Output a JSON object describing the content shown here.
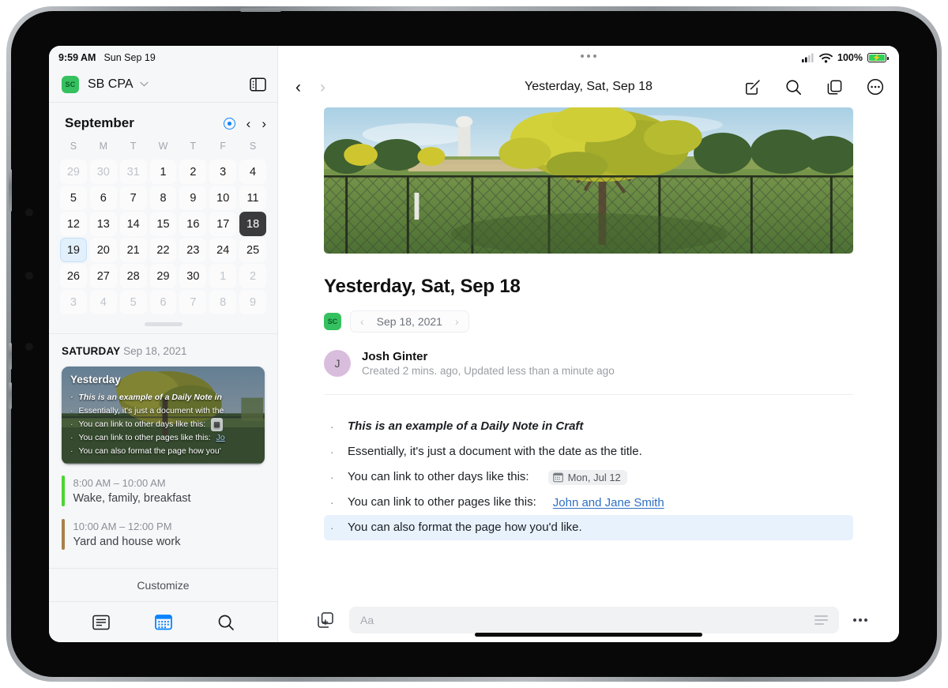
{
  "sidebar": {
    "status": {
      "time": "9:59 AM",
      "date": "Sun Sep 19"
    },
    "account": {
      "badge": "SC",
      "name": "SB CPA",
      "chevron": "⌄"
    },
    "calendar": {
      "month": "September",
      "prev": "‹",
      "next": "›",
      "dow": [
        "S",
        "M",
        "T",
        "W",
        "T",
        "F",
        "S"
      ],
      "weeks": [
        [
          {
            "n": "29",
            "state": "muted"
          },
          {
            "n": "30",
            "state": "muted"
          },
          {
            "n": "31",
            "state": "muted"
          },
          {
            "n": "1",
            "state": "normal"
          },
          {
            "n": "2",
            "state": "normal"
          },
          {
            "n": "3",
            "state": "normal"
          },
          {
            "n": "4",
            "state": "normal"
          }
        ],
        [
          {
            "n": "5",
            "state": "normal"
          },
          {
            "n": "6",
            "state": "normal"
          },
          {
            "n": "7",
            "state": "normal"
          },
          {
            "n": "8",
            "state": "normal"
          },
          {
            "n": "9",
            "state": "normal"
          },
          {
            "n": "10",
            "state": "normal"
          },
          {
            "n": "11",
            "state": "normal"
          }
        ],
        [
          {
            "n": "12",
            "state": "normal"
          },
          {
            "n": "13",
            "state": "normal"
          },
          {
            "n": "14",
            "state": "normal"
          },
          {
            "n": "15",
            "state": "normal"
          },
          {
            "n": "16",
            "state": "normal"
          },
          {
            "n": "17",
            "state": "normal"
          },
          {
            "n": "18",
            "state": "selected"
          }
        ],
        [
          {
            "n": "19",
            "state": "today"
          },
          {
            "n": "20",
            "state": "normal"
          },
          {
            "n": "21",
            "state": "normal"
          },
          {
            "n": "22",
            "state": "normal"
          },
          {
            "n": "23",
            "state": "normal"
          },
          {
            "n": "24",
            "state": "normal"
          },
          {
            "n": "25",
            "state": "normal"
          }
        ],
        [
          {
            "n": "26",
            "state": "normal"
          },
          {
            "n": "27",
            "state": "normal"
          },
          {
            "n": "28",
            "state": "normal"
          },
          {
            "n": "29",
            "state": "normal"
          },
          {
            "n": "30",
            "state": "normal"
          },
          {
            "n": "1",
            "state": "muted"
          },
          {
            "n": "2",
            "state": "muted"
          }
        ],
        [
          {
            "n": "3",
            "state": "muted"
          },
          {
            "n": "4",
            "state": "muted"
          },
          {
            "n": "5",
            "state": "muted"
          },
          {
            "n": "6",
            "state": "muted"
          },
          {
            "n": "7",
            "state": "muted"
          },
          {
            "n": "8",
            "state": "muted"
          },
          {
            "n": "9",
            "state": "muted"
          }
        ]
      ]
    },
    "day": {
      "weekday": "SATURDAY",
      "date": "Sep 18, 2021"
    },
    "note_card": {
      "title": "Yesterday",
      "lines": [
        "This is an example of a Daily Note in",
        "Essentially, it's just a document with the",
        "You can link to other days like this:",
        "You can link to other pages like this:",
        "You can also format the page how you'"
      ],
      "line3_chip": "▦",
      "line4_link": "Jo"
    },
    "events": [
      {
        "time": "8:00 AM – 10:00 AM",
        "title": "Wake, family, breakfast",
        "color": "#4cd435"
      },
      {
        "time": "10:00 AM – 12:00 PM",
        "title": "Yard and house work",
        "color": "#a8804a"
      }
    ],
    "customize_label": "Customize",
    "tabs": [
      {
        "name": "notes-tab",
        "icon": "document-list-icon",
        "active": false
      },
      {
        "name": "calendar-tab",
        "icon": "calendar-icon",
        "active": true
      },
      {
        "name": "search-tab",
        "icon": "search-icon",
        "active": false
      }
    ]
  },
  "main": {
    "status": {
      "battery_percent": "100%",
      "battery_bolt": "⚡"
    },
    "navbar": {
      "back": "‹",
      "forward": "›",
      "title": "Yesterday, Sat, Sep 18",
      "actions": [
        "compose-icon",
        "search-icon",
        "pages-icon",
        "more-circle-icon"
      ]
    },
    "document": {
      "title": "Yesterday, Sat, Sep 18",
      "badge": "SC",
      "date_prev": "‹",
      "date_label": "Sep 18, 2021",
      "date_next": "›",
      "author": {
        "initial": "J",
        "name": "Josh Ginter",
        "meta": "Created 2 mins. ago, Updated less than a minute ago"
      },
      "bullets": [
        {
          "text": "This is an example of a Daily Note in Craft",
          "style": "bold-italic",
          "highlight": false
        },
        {
          "text": "Essentially, it's just a document with the date as the title.",
          "style": "normal",
          "highlight": false
        },
        {
          "text": "You can link to other days like this:",
          "style": "normal",
          "highlight": false,
          "chip": "Mon, Jul 12"
        },
        {
          "text": "You can link to other pages like this:",
          "style": "normal",
          "highlight": false,
          "link": "John and Jane Smith"
        },
        {
          "text": "You can also format the page how you'd like.",
          "style": "normal",
          "highlight": true
        }
      ]
    },
    "bottom_bar": {
      "insert_icon": "add-page-icon",
      "format_placeholder": "Aa",
      "more_icon": "more-icon"
    }
  },
  "colors": {
    "accent_blue": "#0a84ff",
    "badge_green": "#35c15f",
    "battery_green": "#31d158",
    "highlight_blue": "#e8f2fd",
    "link_blue": "#2d6fc4",
    "sidebar_bg": "#f6f7f9"
  }
}
